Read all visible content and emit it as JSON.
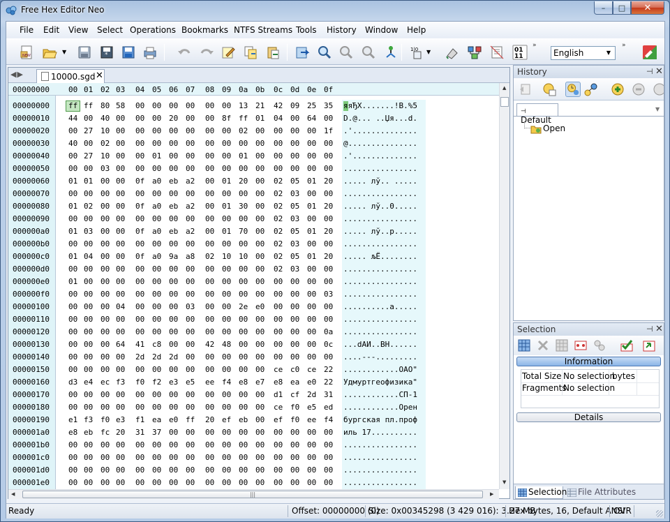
{
  "window": {
    "title": "Free Hex Editor Neo",
    "minimize": "–",
    "maximize": "□",
    "close": "✕"
  },
  "menu": [
    "File",
    "Edit",
    "View",
    "Select",
    "Operations",
    "Bookmarks",
    "NTFS Streams",
    "Tools",
    "History",
    "Window",
    "Help"
  ],
  "toolbar": {
    "language": "English",
    "icons": [
      "new-file-icon",
      "open-file-icon",
      "open-dropdown-icon",
      "save-icon",
      "save-all-icon",
      "save-as-icon",
      "print-icon",
      "undo-icon",
      "redo-icon",
      "edit-icon",
      "copy-icon",
      "paste-icon",
      "goto-icon",
      "find-icon",
      "find-next-icon",
      "find-prev-icon",
      "bookmark-icon",
      "columns-icon",
      "encoding-icon",
      "fill-icon",
      "compare-icon",
      "properties-icon",
      "binary-view-icon",
      "logo-icon"
    ]
  },
  "editor": {
    "tab_label": "10000.sgd",
    "tab_close": "✕",
    "tab_nav": "◀▶",
    "header_offset": "00000000",
    "header_bytes": [
      "00",
      "01",
      "02",
      "03",
      "04",
      "05",
      "06",
      "07",
      "08",
      "09",
      "0a",
      "0b",
      "0c",
      "0d",
      "0e",
      "0f"
    ],
    "rows": [
      {
        "off": "00000000",
        "b": [
          "ff",
          "ff",
          "80",
          "58",
          "00",
          "00",
          "00",
          "00",
          "00",
          "00",
          "13",
          "21",
          "42",
          "09",
          "25",
          "35"
        ],
        "a": "яяЂX.......!B.%5"
      },
      {
        "off": "00000010",
        "b": [
          "44",
          "00",
          "40",
          "00",
          "00",
          "00",
          "20",
          "00",
          "00",
          "8f",
          "ff",
          "01",
          "04",
          "00",
          "64",
          "00"
        ],
        "a": "D.@... ..Џя...d."
      },
      {
        "off": "00000020",
        "b": [
          "00",
          "27",
          "10",
          "00",
          "00",
          "00",
          "00",
          "00",
          "00",
          "00",
          "02",
          "00",
          "00",
          "00",
          "00",
          "1f"
        ],
        "a": ".'.............."
      },
      {
        "off": "00000030",
        "b": [
          "40",
          "00",
          "02",
          "00",
          "00",
          "00",
          "00",
          "00",
          "00",
          "00",
          "00",
          "00",
          "00",
          "00",
          "00",
          "00"
        ],
        "a": "@..............."
      },
      {
        "off": "00000040",
        "b": [
          "00",
          "27",
          "10",
          "00",
          "00",
          "01",
          "00",
          "00",
          "00",
          "00",
          "01",
          "00",
          "00",
          "00",
          "00",
          "00"
        ],
        "a": ".'.............."
      },
      {
        "off": "00000050",
        "b": [
          "00",
          "00",
          "03",
          "00",
          "00",
          "00",
          "00",
          "00",
          "00",
          "00",
          "00",
          "00",
          "00",
          "00",
          "00",
          "00"
        ],
        "a": "................"
      },
      {
        "off": "00000060",
        "b": [
          "01",
          "01",
          "00",
          "00",
          "0f",
          "a0",
          "eb",
          "a2",
          "00",
          "01",
          "20",
          "00",
          "02",
          "05",
          "01",
          "20"
        ],
        "a": "..... лў.. ....."
      },
      {
        "off": "00000070",
        "b": [
          "00",
          "00",
          "00",
          "00",
          "00",
          "00",
          "00",
          "00",
          "00",
          "00",
          "00",
          "00",
          "02",
          "03",
          "00",
          "00"
        ],
        "a": "................"
      },
      {
        "off": "00000080",
        "b": [
          "01",
          "02",
          "00",
          "00",
          "0f",
          "a0",
          "eb",
          "a2",
          "00",
          "01",
          "30",
          "00",
          "02",
          "05",
          "01",
          "20"
        ],
        "a": "..... лў..0....."
      },
      {
        "off": "00000090",
        "b": [
          "00",
          "00",
          "00",
          "00",
          "00",
          "00",
          "00",
          "00",
          "00",
          "00",
          "00",
          "00",
          "02",
          "03",
          "00",
          "00"
        ],
        "a": "................"
      },
      {
        "off": "000000a0",
        "b": [
          "01",
          "03",
          "00",
          "00",
          "0f",
          "a0",
          "eb",
          "a2",
          "00",
          "01",
          "70",
          "00",
          "02",
          "05",
          "01",
          "20"
        ],
        "a": "..... лў..p....."
      },
      {
        "off": "000000b0",
        "b": [
          "00",
          "00",
          "00",
          "00",
          "00",
          "00",
          "00",
          "00",
          "00",
          "00",
          "00",
          "00",
          "02",
          "03",
          "00",
          "00"
        ],
        "a": "................"
      },
      {
        "off": "000000c0",
        "b": [
          "01",
          "04",
          "00",
          "00",
          "0f",
          "a0",
          "9a",
          "a8",
          "02",
          "10",
          "10",
          "00",
          "02",
          "05",
          "01",
          "20"
        ],
        "a": "..... љЁ........"
      },
      {
        "off": "000000d0",
        "b": [
          "00",
          "00",
          "00",
          "00",
          "00",
          "00",
          "00",
          "00",
          "00",
          "00",
          "00",
          "00",
          "02",
          "03",
          "00",
          "00"
        ],
        "a": "................"
      },
      {
        "off": "000000e0",
        "b": [
          "01",
          "00",
          "00",
          "00",
          "00",
          "00",
          "00",
          "00",
          "00",
          "00",
          "00",
          "00",
          "00",
          "00",
          "00",
          "00"
        ],
        "a": "................"
      },
      {
        "off": "000000f0",
        "b": [
          "00",
          "00",
          "00",
          "00",
          "00",
          "00",
          "00",
          "00",
          "00",
          "00",
          "00",
          "00",
          "00",
          "00",
          "00",
          "03"
        ],
        "a": "................"
      },
      {
        "off": "00000100",
        "b": [
          "00",
          "00",
          "00",
          "04",
          "00",
          "00",
          "00",
          "03",
          "00",
          "00",
          "2e",
          "e0",
          "00",
          "00",
          "00",
          "00"
        ],
        "a": "..........а....."
      },
      {
        "off": "00000110",
        "b": [
          "00",
          "00",
          "00",
          "00",
          "00",
          "00",
          "00",
          "00",
          "00",
          "00",
          "00",
          "00",
          "00",
          "00",
          "00",
          "00"
        ],
        "a": "................"
      },
      {
        "off": "00000120",
        "b": [
          "00",
          "00",
          "00",
          "00",
          "00",
          "00",
          "00",
          "00",
          "00",
          "00",
          "00",
          "00",
          "00",
          "00",
          "00",
          "0a"
        ],
        "a": "................"
      },
      {
        "off": "00000130",
        "b": [
          "00",
          "00",
          "00",
          "64",
          "41",
          "c8",
          "00",
          "00",
          "42",
          "48",
          "00",
          "00",
          "00",
          "00",
          "00",
          "0c"
        ],
        "a": "...dAИ..BH......"
      },
      {
        "off": "00000140",
        "b": [
          "00",
          "00",
          "00",
          "00",
          "2d",
          "2d",
          "2d",
          "00",
          "00",
          "00",
          "00",
          "00",
          "00",
          "00",
          "00",
          "00"
        ],
        "a": "....---........."
      },
      {
        "off": "00000150",
        "b": [
          "00",
          "00",
          "00",
          "00",
          "00",
          "00",
          "00",
          "00",
          "00",
          "00",
          "00",
          "00",
          "ce",
          "c0",
          "ce",
          "22"
        ],
        "a": "............ОАО\""
      },
      {
        "off": "00000160",
        "b": [
          "d3",
          "e4",
          "ec",
          "f3",
          "f0",
          "f2",
          "e3",
          "e5",
          "ee",
          "f4",
          "e8",
          "e7",
          "e8",
          "ea",
          "e0",
          "22"
        ],
        "a": "Удмуртгеофизика\""
      },
      {
        "off": "00000170",
        "b": [
          "00",
          "00",
          "00",
          "00",
          "00",
          "00",
          "00",
          "00",
          "00",
          "00",
          "00",
          "00",
          "d1",
          "cf",
          "2d",
          "31"
        ],
        "a": "............СП-1"
      },
      {
        "off": "00000180",
        "b": [
          "00",
          "00",
          "00",
          "00",
          "00",
          "00",
          "00",
          "00",
          "00",
          "00",
          "00",
          "00",
          "ce",
          "f0",
          "e5",
          "ed"
        ],
        "a": "............Орен"
      },
      {
        "off": "00000190",
        "b": [
          "e1",
          "f3",
          "f0",
          "e3",
          "f1",
          "ea",
          "e0",
          "ff",
          "20",
          "ef",
          "eb",
          "00",
          "ef",
          "f0",
          "ee",
          "f4"
        ],
        "a": "бургская пл.проф"
      },
      {
        "off": "000001a0",
        "b": [
          "e8",
          "eb",
          "fc",
          "20",
          "31",
          "37",
          "00",
          "00",
          "00",
          "00",
          "00",
          "00",
          "00",
          "00",
          "00",
          "00"
        ],
        "a": "иль 17.........."
      },
      {
        "off": "000001b0",
        "b": [
          "00",
          "00",
          "00",
          "00",
          "00",
          "00",
          "00",
          "00",
          "00",
          "00",
          "00",
          "00",
          "00",
          "00",
          "00",
          "00"
        ],
        "a": "................"
      },
      {
        "off": "000001c0",
        "b": [
          "00",
          "00",
          "00",
          "00",
          "00",
          "00",
          "00",
          "00",
          "00",
          "00",
          "00",
          "00",
          "00",
          "00",
          "00",
          "00"
        ],
        "a": "................"
      },
      {
        "off": "000001d0",
        "b": [
          "00",
          "00",
          "00",
          "00",
          "00",
          "00",
          "00",
          "00",
          "00",
          "00",
          "00",
          "00",
          "00",
          "00",
          "00",
          "00"
        ],
        "a": "................"
      },
      {
        "off": "000001e0",
        "b": [
          "00",
          "00",
          "00",
          "00",
          "00",
          "00",
          "00",
          "00",
          "00",
          "00",
          "00",
          "00",
          "00",
          "00",
          "00",
          "00"
        ],
        "a": "................"
      }
    ]
  },
  "history": {
    "title": "History",
    "pin": "⊣",
    "close": "✕",
    "tab": "Default",
    "entry": "Open"
  },
  "selection": {
    "title": "Selection",
    "pin": "⊣",
    "close": "✕",
    "information": "Information",
    "details": "Details",
    "total_size_label": "Total Size",
    "total_size_value": "No selection",
    "total_size_unit": "bytes",
    "fragments_label": "Fragments",
    "fragments_value": "No selection",
    "tab_selection": "Selection",
    "tab_attributes": "File Attributes"
  },
  "status": {
    "ready": "Ready",
    "offset": "Offset: 00000000 (0)",
    "size": "Size: 0x00345298 (3 429 016): 3.27 MB",
    "mode": "Hex bytes, 16, Default ANSI",
    "ovr": "OVR"
  }
}
